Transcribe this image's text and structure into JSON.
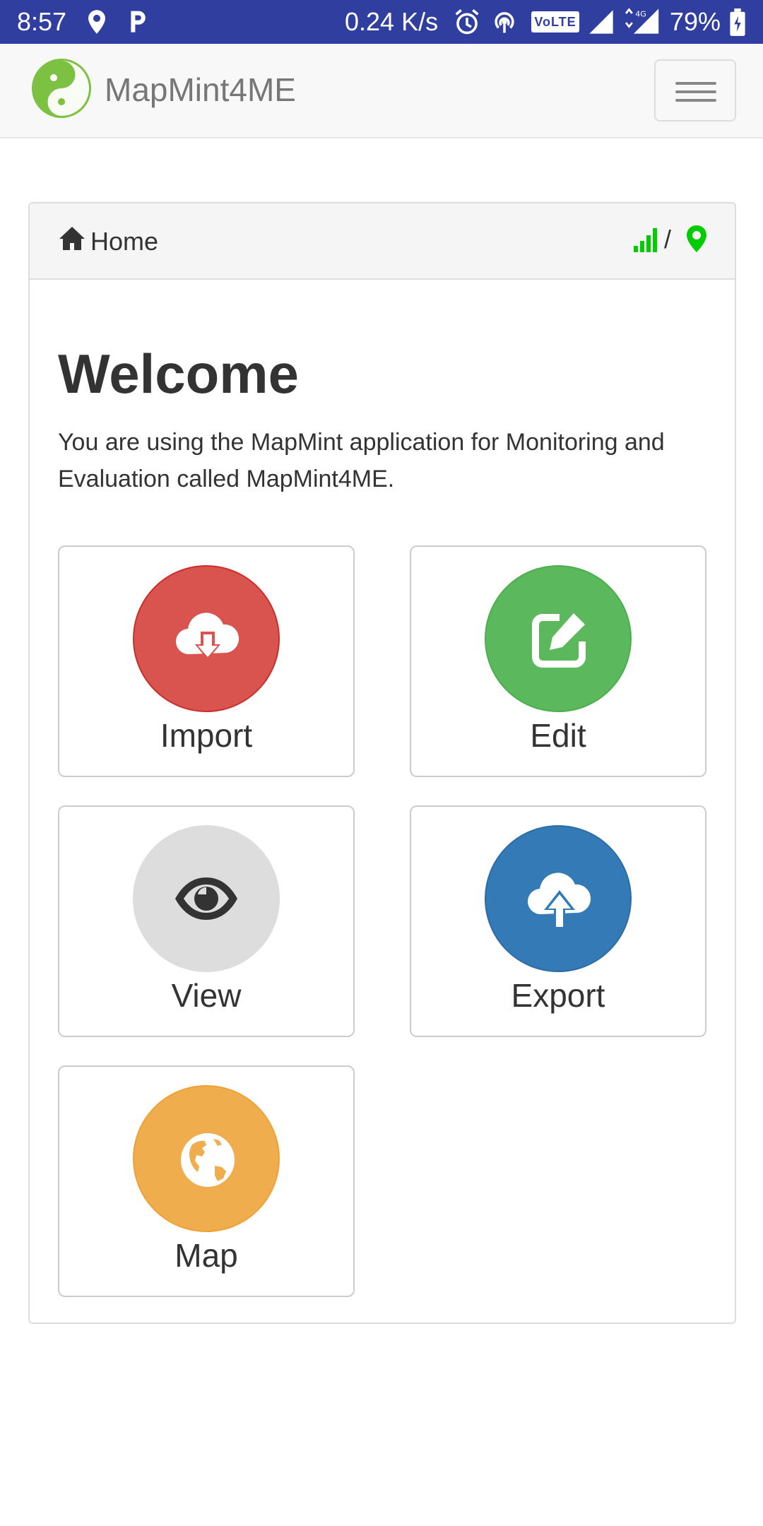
{
  "status_bar": {
    "time": "8:57",
    "net_speed": "0.24 K/s",
    "volte": "VoLTE",
    "battery": "79%",
    "bar_color": "#303f9f"
  },
  "navbar": {
    "brand": "MapMint4ME",
    "logo_color": "#7cc142",
    "menu_icon": "hamburger-icon"
  },
  "breadcrumb": {
    "home_label": "Home",
    "separator": "/",
    "signal_color": "#00cc00",
    "pin_color": "#00cc00"
  },
  "main": {
    "title": "Welcome",
    "description": "You are using the MapMint application for Monitoring and Evaluation called MapMint4ME."
  },
  "tiles": [
    {
      "label": "Import",
      "icon": "cloud-download-icon",
      "color": "#d9534f"
    },
    {
      "label": "Edit",
      "icon": "edit-icon",
      "color": "#5cb85c"
    },
    {
      "label": "View",
      "icon": "eye-icon",
      "color": "#dddddd"
    },
    {
      "label": "Export",
      "icon": "cloud-upload-icon",
      "color": "#337ab7"
    },
    {
      "label": "Map",
      "icon": "globe-icon",
      "color": "#f0ad4e"
    }
  ]
}
